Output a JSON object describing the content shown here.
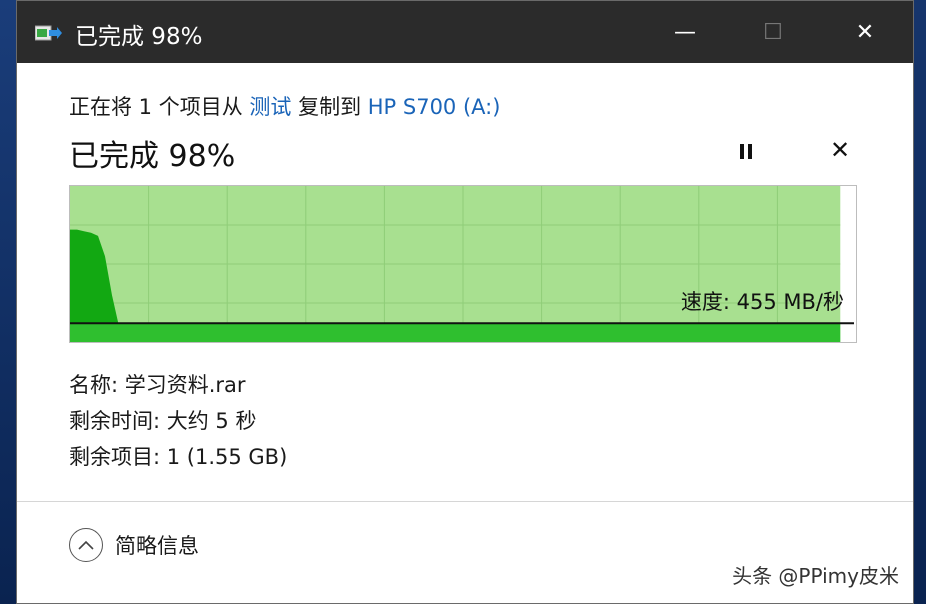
{
  "window": {
    "title": "已完成 98%",
    "controls": {
      "minimize": "—",
      "maximize": "☐",
      "close": "✕"
    }
  },
  "copy": {
    "prefix": "正在将 1 个项目从 ",
    "source": "测试",
    "middle": " 复制到 ",
    "destination": "HP S700 (A:)"
  },
  "progress": {
    "status": "已完成 98%",
    "percent_done": 98
  },
  "buttons": {
    "pause": "pause-icon",
    "stop": "✕"
  },
  "speed_graph": {
    "speed_label": "速度: 455 MB/秒",
    "speed_samples": [
      0.72,
      0.72,
      0.71,
      0.7,
      0.68,
      0.55,
      0.3,
      0.1,
      0.08,
      0.08,
      0.08,
      0.08,
      0.08,
      0.08,
      0.08,
      0.08,
      0.08,
      0.08,
      0.08,
      0.08,
      0.08,
      0.08,
      0.08,
      0.08
    ],
    "current_speed_level": 0.12,
    "colors": {
      "background": "#a8e090",
      "completed_fill": "#2fbf2f",
      "graph_fill": "#12a812",
      "grid": "#8fcd78",
      "line": "#111111"
    }
  },
  "details": {
    "name": "名称: 学习资料.rar",
    "time_remaining": "剩余时间: 大约 5 秒",
    "items_remaining": "剩余项目: 1 (1.55 GB)"
  },
  "footer": {
    "toggle_label": "简略信息"
  },
  "watermark": "头条 @PPimy皮米"
}
